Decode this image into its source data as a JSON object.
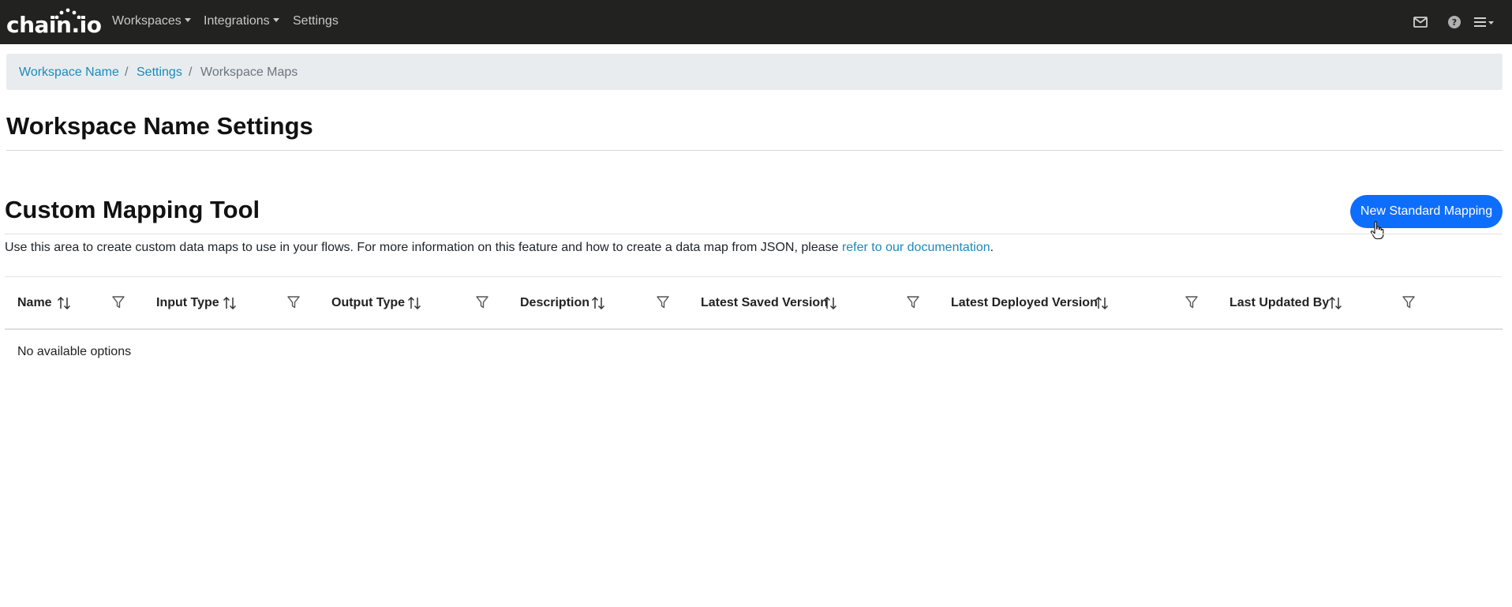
{
  "navbar": {
    "logo_text": "chain.io",
    "links": {
      "workspaces": "Workspaces",
      "integrations": "Integrations",
      "settings": "Settings"
    },
    "icons": [
      "mail-icon",
      "help-icon",
      "menu-icon"
    ]
  },
  "breadcrumb": {
    "items": [
      "Workspace Name",
      "Settings",
      "Workspace Maps"
    ],
    "separator": "/"
  },
  "page": {
    "title": "Workspace Name Settings"
  },
  "section": {
    "title": "Custom Mapping Tool",
    "new_button_label": "New Standard Mapping",
    "description": "Use this area to create custom data maps to use in your flows. For more information on this feature and how to create a data map from JSON, please ",
    "doc_link": "refer to our documentation",
    "description_end": "."
  },
  "table": {
    "columns": [
      "Name",
      "Input Type",
      "Output Type",
      "Description",
      "Latest Saved Version",
      "Latest Deployed Version",
      "Last Updated By"
    ],
    "empty_message": "No available options"
  },
  "colors": {
    "navbar_bg": "#222220",
    "primary": "#0d6efd",
    "link": "#1b8ab8",
    "breadcrumb_bg": "#e9ecef"
  }
}
